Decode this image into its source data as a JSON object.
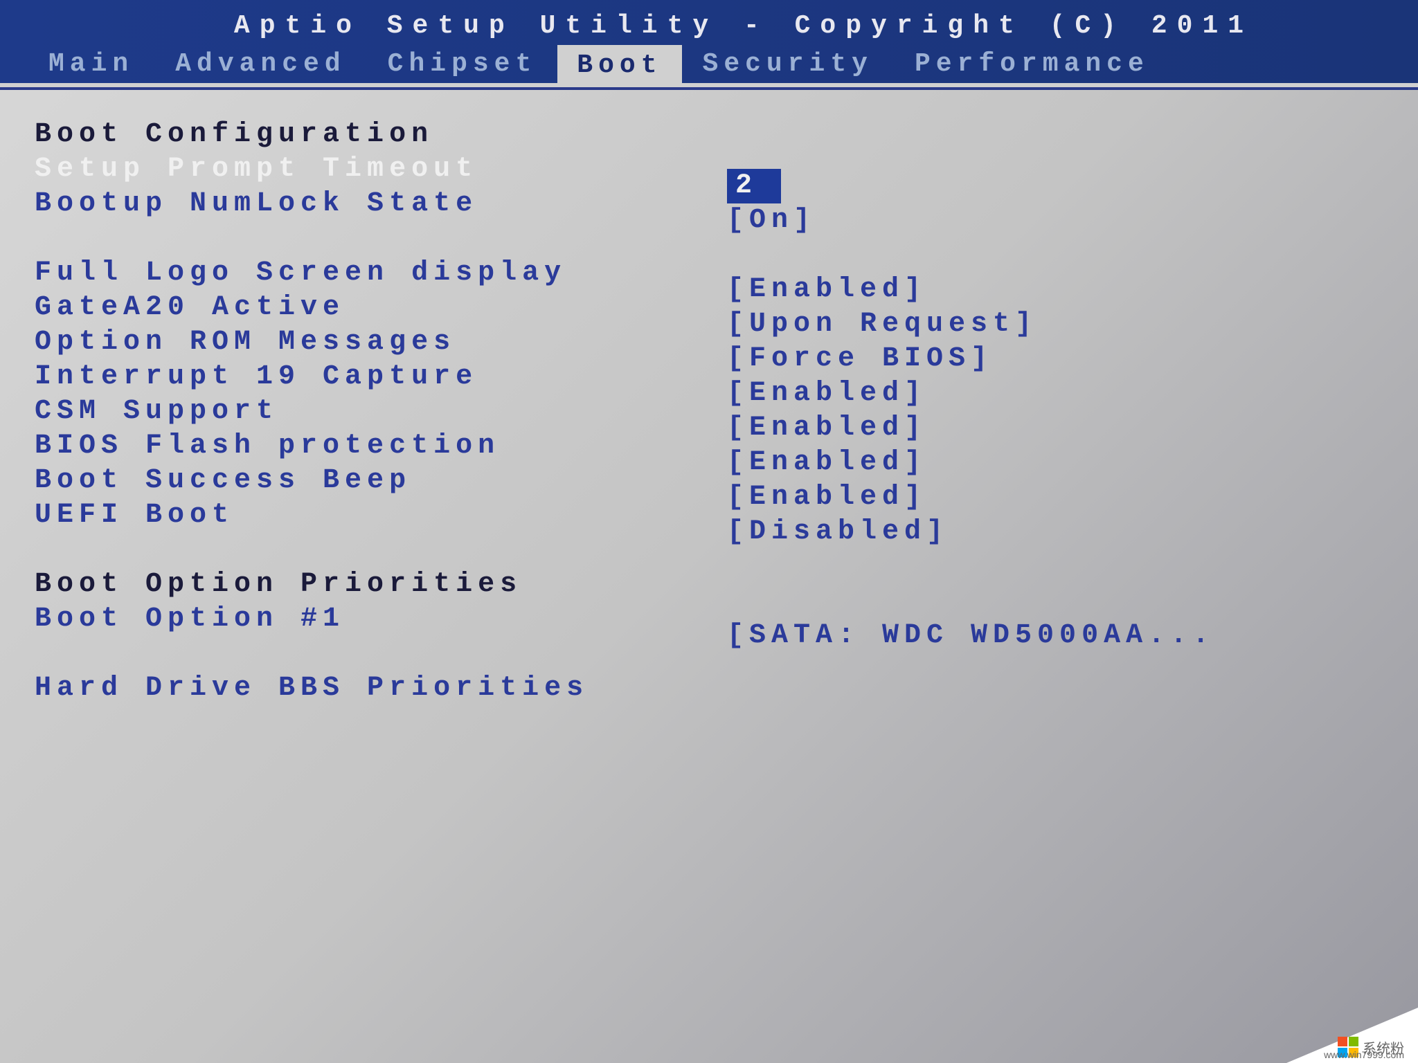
{
  "header": {
    "title": "Aptio Setup Utility - Copyright (C) 2011"
  },
  "tabs": [
    {
      "label": "Main",
      "active": false
    },
    {
      "label": "Advanced",
      "active": false
    },
    {
      "label": "Chipset",
      "active": false
    },
    {
      "label": "Boot",
      "active": true
    },
    {
      "label": "Security",
      "active": false
    },
    {
      "label": "Performance",
      "active": false
    }
  ],
  "sections": {
    "boot_config_header": "Boot Configuration",
    "boot_priorities_header": "Boot Option Priorities",
    "hard_drive_bbs": "Hard Drive BBS Priorities"
  },
  "settings": [
    {
      "key": "setup_prompt_timeout",
      "label": "Setup Prompt Timeout",
      "value": "2",
      "selected": true
    },
    {
      "key": "bootup_numlock",
      "label": "Bootup NumLock State",
      "value": "[On]",
      "selected": false
    },
    {
      "key": "full_logo",
      "label": "Full Logo Screen display",
      "value": "[Enabled]",
      "selected": false
    },
    {
      "key": "gatea20",
      "label": "GateA20 Active",
      "value": "[Upon Request]",
      "selected": false
    },
    {
      "key": "option_rom",
      "label": "Option ROM Messages",
      "value": "[Force BIOS]",
      "selected": false
    },
    {
      "key": "interrupt19",
      "label": "Interrupt 19 Capture",
      "value": "[Enabled]",
      "selected": false
    },
    {
      "key": "csm_support",
      "label": "CSM Support",
      "value": "[Enabled]",
      "selected": false
    },
    {
      "key": "bios_flash",
      "label": "BIOS Flash protection",
      "value": "[Enabled]",
      "selected": false
    },
    {
      "key": "boot_beep",
      "label": "Boot Success Beep",
      "value": "[Enabled]",
      "selected": false
    },
    {
      "key": "uefi_boot",
      "label": "UEFI Boot",
      "value": "[Disabled]",
      "selected": false
    }
  ],
  "boot_options": [
    {
      "key": "boot_option_1",
      "label": "Boot Option #1",
      "value": "[SATA: WDC WD5000AA..."
    }
  ],
  "watermark": {
    "text": "系统粉",
    "url": "www.win7999.com"
  }
}
